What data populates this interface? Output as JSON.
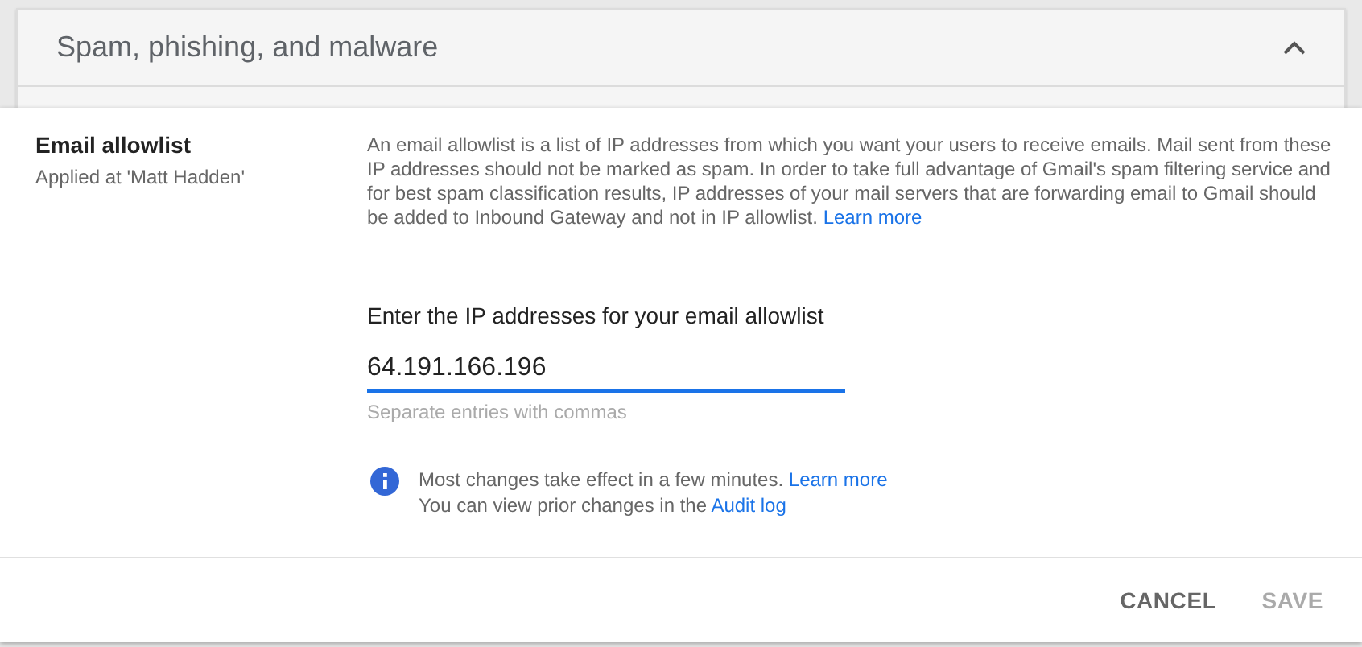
{
  "section": {
    "title": "Spam, phishing, and malware",
    "expanded": true
  },
  "setting": {
    "name": "Email allowlist",
    "scope": "Applied at 'Matt Hadden'"
  },
  "description": {
    "text": "An email allowlist is a list of IP addresses from which you want your users to receive emails. Mail sent from these IP addresses should not be marked as spam. In order to take full advantage of Gmail's spam filtering service and for best spam classification results, IP addresses of your mail servers that are forwarding email to Gmail should be added to Inbound Gateway and not in IP allowlist.",
    "link": "Learn more"
  },
  "field": {
    "label": "Enter the IP addresses for your email allowlist",
    "value": "64.191.166.196",
    "hint": "Separate entries with commas",
    "focused": true
  },
  "notice": [
    {
      "text": "Most changes take effect in a few minutes.",
      "link": "Learn more"
    },
    {
      "text": "You can view prior changes in the",
      "link": "Audit log"
    }
  ],
  "buttons": [
    {
      "label": "CANCEL",
      "disabled": false
    },
    {
      "label": "SAVE",
      "disabled": true
    }
  ]
}
